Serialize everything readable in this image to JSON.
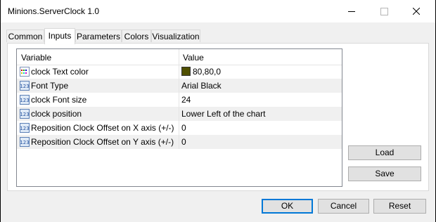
{
  "window": {
    "title": "Minions.ServerClock 1.0"
  },
  "tabs": [
    {
      "label": "Common"
    },
    {
      "label": "Inputs"
    },
    {
      "label": "Parameters"
    },
    {
      "label": "Colors"
    },
    {
      "label": "Visualization"
    }
  ],
  "grid": {
    "headers": {
      "variable": "Variable",
      "value": "Value"
    },
    "rows": [
      {
        "name": "clock Text color",
        "value": "80,80,0",
        "icon": "color-icon",
        "color": "#505000"
      },
      {
        "name": "Font Type",
        "value": "Arial Black",
        "icon": "numeric-123-icon"
      },
      {
        "name": "clock Font size",
        "value": "24",
        "icon": "numeric-123-icon"
      },
      {
        "name": "clock position",
        "value": "Lower Left of the chart",
        "icon": "numeric-123-icon"
      },
      {
        "name": "Reposition Clock Offset on X axis (+/-)",
        "value": "0",
        "icon": "numeric-123-icon"
      },
      {
        "name": "Reposition Clock Offset on Y axis (+/-)",
        "value": "0",
        "icon": "numeric-123-icon"
      }
    ]
  },
  "side_buttons": {
    "load": "Load",
    "save": "Save"
  },
  "footer": {
    "ok": "OK",
    "cancel": "Cancel",
    "reset": "Reset"
  },
  "colors": {
    "accent": "#0078d7"
  }
}
